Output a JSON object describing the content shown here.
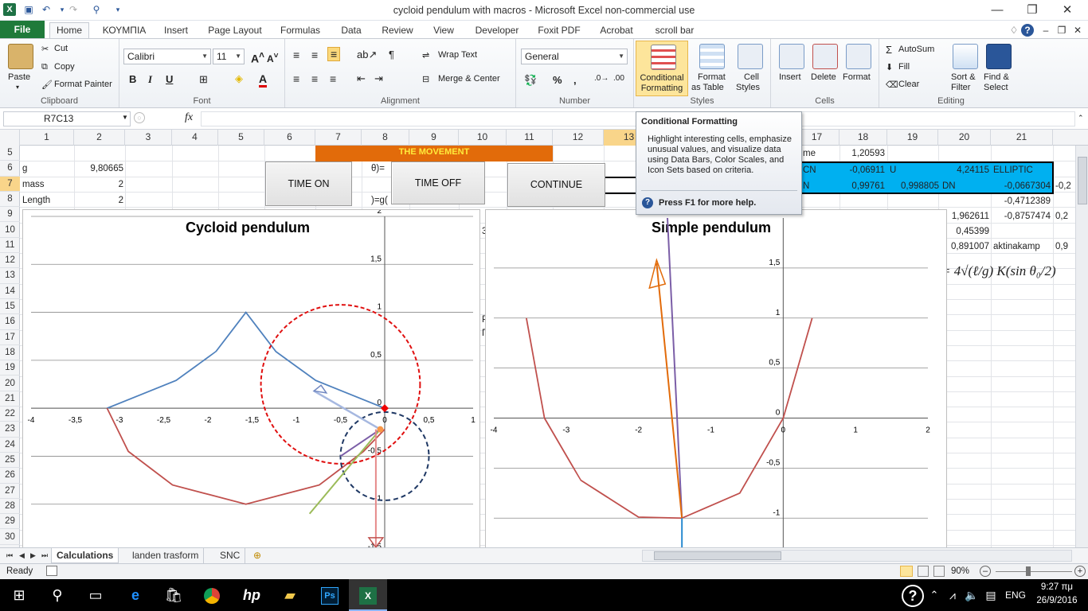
{
  "window": {
    "title": "cycloid pendulum with macros - Microsoft Excel non-commercial use"
  },
  "quick_access": {
    "save": "save-icon",
    "undo": "undo-icon",
    "redo": "redo-icon"
  },
  "ribbon_tabs": [
    "File",
    "Home",
    "ΚΟΥΜΠΙΑ",
    "Insert",
    "Page Layout",
    "Formulas",
    "Data",
    "Review",
    "View",
    "Developer",
    "Foxit PDF",
    "Acrobat",
    "scroll bar"
  ],
  "clipboard": {
    "paste": "Paste",
    "cut": "Cut",
    "copy": "Copy",
    "format_painter": "Format Painter",
    "label": "Clipboard"
  },
  "font": {
    "name": "Calibri",
    "size": "11",
    "bold": "B",
    "italic": "I",
    "underline": "U",
    "label": "Font"
  },
  "alignment": {
    "wrap_text": "Wrap Text",
    "merge_center": "Merge & Center",
    "label": "Alignment"
  },
  "number": {
    "format": "General",
    "label": "Number"
  },
  "styles": {
    "conditional_1": "Conditional",
    "conditional_2": "Formatting",
    "format_table_1": "Format",
    "format_table_2": "as Table",
    "cell_styles_1": "Cell",
    "cell_styles_2": "Styles",
    "label": "Styles"
  },
  "cells": {
    "insert": "Insert",
    "delete": "Delete",
    "format": "Format",
    "label": "Cells"
  },
  "editing": {
    "autosum": "AutoSum",
    "fill": "Fill",
    "clear": "Clear",
    "sort_1": "Sort &",
    "sort_2": "Filter",
    "find_1": "Find &",
    "find_2": "Select",
    "label": "Editing"
  },
  "formula_bar": {
    "name_box": "R7C13",
    "fx": "fx",
    "formula": ""
  },
  "columns": [
    "1",
    "2",
    "3",
    "4",
    "5",
    "6",
    "7",
    "8",
    "9",
    "10",
    "11",
    "12",
    "13",
    "14",
    "15",
    "16",
    "17",
    "18",
    "19",
    "20",
    "21"
  ],
  "rows": [
    "5",
    "6",
    "7",
    "8",
    "9",
    "10",
    "11",
    "12",
    "13",
    "14",
    "15",
    "16",
    "17",
    "18",
    "19",
    "20",
    "21",
    "22",
    "23",
    "24",
    "25",
    "26",
    "27",
    "28",
    "29",
    "30",
    "31",
    "32"
  ],
  "sheet_cells": {
    "movement": "THE MOVEMENT",
    "g_label": "g",
    "g_value": "9,80665",
    "mass_label": "mass",
    "mass_value": "2",
    "length_label": "Length",
    "length_value": "2",
    "theta_eq": "θ)=",
    "g_eq": ")=g(",
    "time_label": "me",
    "time_value": "1,20593",
    "cn_label": "CN",
    "cn_value": "-0,06911",
    "u_label": "U",
    "u_value": "4,24115",
    "elliptic": "ELLIPTIC",
    "dn_label": "N",
    "dn_value": "0,99761",
    "dn_value2": "0,998805",
    "dn_text": "DN",
    "neg_value": "-0,0667304",
    "neg_trunc": "-0,2",
    "v8": "-0,4712389",
    "v9a": "1,962611",
    "v9b": "-0,8757474",
    "v9c": "0,2",
    "v10": "0,45399",
    "v11a": "0,891007",
    "v11b": "aktinakamp",
    "v11c": "0,9",
    "formula_display": "= 4√(ℓ/g) K(sin θ₀/2)",
    "frag_row9": "3",
    "frag_row16": "P",
    "frag_row17": "Π"
  },
  "buttons": {
    "time_on": "TIME ON",
    "time_off": "TIME OFF",
    "continue": "CONTINUE"
  },
  "tooltip": {
    "title": "Conditional Formatting",
    "body": "Highlight interesting cells, emphasize unusual values, and visualize data using Data Bars, Color Scales, and Icon Sets based on criteria.",
    "help": "Press F1 for more help."
  },
  "chart_data": [
    {
      "type": "line",
      "title": "Cycloid pendulum",
      "xlim": [
        -4,
        1
      ],
      "ylim": [
        -1.5,
        2
      ],
      "x_ticks": [
        "-4",
        "-3,5",
        "-3",
        "-2,5",
        "-2",
        "-1,5",
        "-1",
        "-0,5",
        "0",
        "0,5",
        "1"
      ],
      "y_ticks": [
        "2",
        "1,5",
        "1",
        "0,5",
        "0",
        "-0,5",
        "-1",
        "-1,5"
      ],
      "series": [
        {
          "color": "#4f81bd",
          "points": [
            [
              -3.14,
              0
            ],
            [
              -2.36,
              0.29
            ],
            [
              -1.91,
              0.59
            ],
            [
              -1.57,
              1
            ],
            [
              -1.23,
              0.59
            ],
            [
              -0.78,
              0.29
            ],
            [
              0,
              0
            ]
          ]
        },
        {
          "color": "#c0504d",
          "points": [
            [
              -3.14,
              0
            ],
            [
              -2.9,
              -0.45
            ],
            [
              -2.4,
              -0.8
            ],
            [
              -1.57,
              -1
            ],
            [
              -0.74,
              -0.8
            ],
            [
              -0.24,
              -0.45
            ],
            [
              0,
              -0.22
            ]
          ]
        }
      ]
    },
    {
      "type": "line",
      "title": "Simple pendulum",
      "xlim": [
        -4,
        2
      ],
      "ylim": [
        -1.3,
        2
      ],
      "x_ticks": [
        "-4",
        "-3",
        "-2",
        "-1",
        "0",
        "1",
        "2"
      ],
      "y_ticks": [
        "1,5",
        "1",
        "0,5",
        "0",
        "-0,5",
        "-1"
      ],
      "series": [
        {
          "color": "#c0504d",
          "points": [
            [
              -3.55,
              1
            ],
            [
              -3.3,
              0
            ],
            [
              -2.8,
              -0.62
            ],
            [
              -2,
              -0.99
            ],
            [
              -1.4,
              -1
            ],
            [
              -0.6,
              -0.75
            ],
            [
              0,
              0
            ],
            [
              0.4,
              1
            ]
          ]
        }
      ]
    }
  ],
  "sheet_tabs": [
    "Calculations",
    "landen trasform",
    "SNC"
  ],
  "status": {
    "ready": "Ready",
    "zoom": "90%"
  },
  "taskbar": {
    "time": "9:27 πμ",
    "date": "26/9/2016",
    "lang": "ENG"
  }
}
